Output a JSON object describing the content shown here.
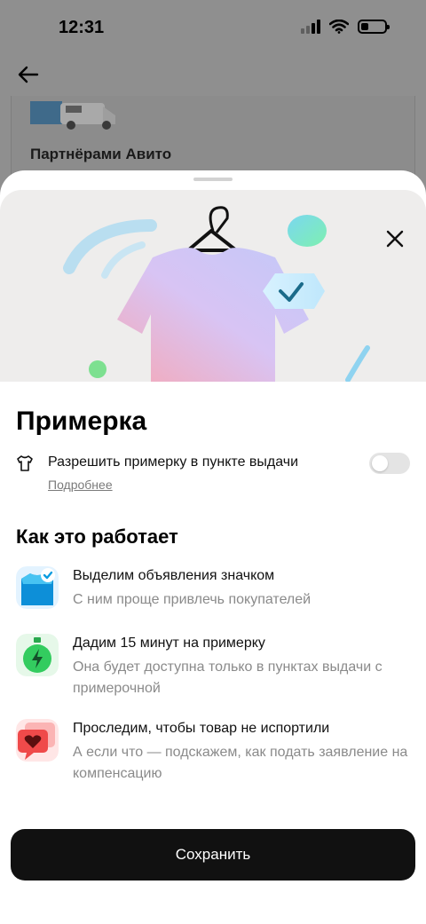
{
  "status_bar": {
    "time": "12:31"
  },
  "background": {
    "partner_label": "Партнёрами Авито"
  },
  "sheet": {
    "title": "Примерка",
    "toggle_label": "Разрешить примерку в пункте выдачи",
    "toggle_state": "off",
    "more_link": "Подробнее",
    "how_title": "Как это работает",
    "features": [
      {
        "icon": "badge-icon",
        "title": "Выделим объявления значком",
        "desc": "С ним проще привлечь покупателей"
      },
      {
        "icon": "timer-icon",
        "title": "Дадим 15 минут на примерку",
        "desc": "Она будет доступна только в пунктах выдачи с примерочной"
      },
      {
        "icon": "heart-message-icon",
        "title": "Проследим, чтобы товар не испортили",
        "desc": "А если что — подскажем, как подать заявление на компенсацию"
      }
    ],
    "save_label": "Сохранить"
  },
  "colors": {
    "accent_blue": "#0aa0e8",
    "accent_green": "#30c85a",
    "accent_red": "#f04848",
    "button_bg": "#111111"
  }
}
